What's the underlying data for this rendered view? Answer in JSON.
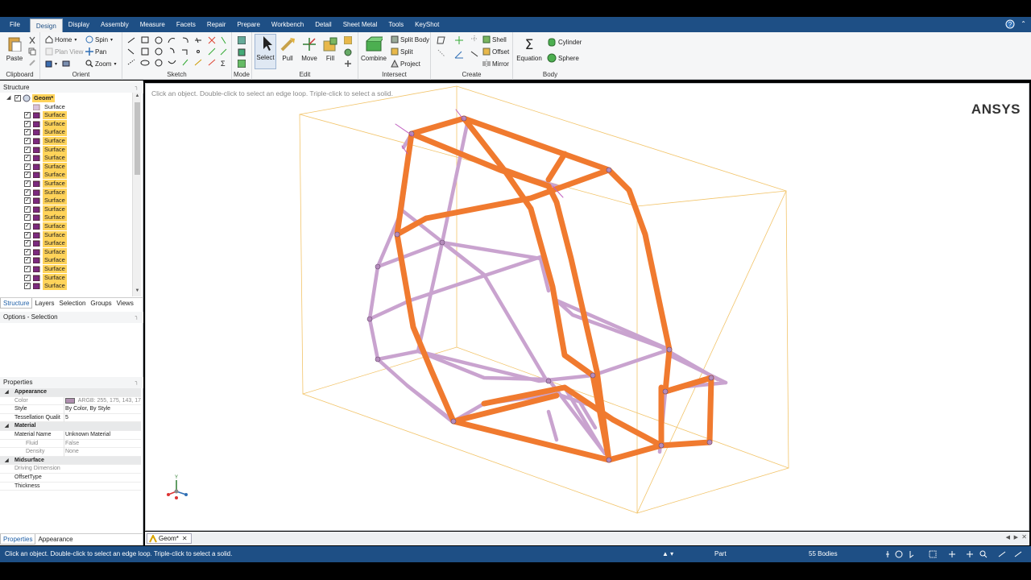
{
  "menu": {
    "file": "File",
    "items": [
      "Design",
      "Display",
      "Assembly",
      "Measure",
      "Facets",
      "Repair",
      "Prepare",
      "Workbench",
      "Detail",
      "Sheet Metal",
      "Tools",
      "KeyShot"
    ],
    "help_icon": "help-icon",
    "minimize_icon": "ribbon-minimize-icon"
  },
  "ribbon": {
    "clipboard": {
      "label": "Clipboard",
      "paste": "Paste"
    },
    "orient": {
      "label": "Orient",
      "home": "Home",
      "spin": "Spin",
      "plan_view": "Plan View",
      "pan": "Pan",
      "zoom": "Zoom"
    },
    "sketch": {
      "label": "Sketch"
    },
    "mode": {
      "label": "Mode"
    },
    "edit": {
      "label": "Edit",
      "select": "Select",
      "pull": "Pull",
      "move": "Move",
      "fill": "Fill"
    },
    "intersect": {
      "label": "Intersect",
      "combine": "Combine",
      "split_body": "Split Body",
      "split": "Split",
      "project": "Project"
    },
    "create": {
      "label": "Create",
      "shell": "Shell",
      "offset": "Offset",
      "mirror": "Mirror"
    },
    "body": {
      "label": "Body",
      "equation": "Equation",
      "cylinder": "Cylinder",
      "sphere": "Sphere"
    }
  },
  "structure": {
    "title": "Structure",
    "root": "Geom*",
    "first_item": "Surface",
    "item_label": "Surface",
    "visible_selected_rows": 21
  },
  "left_tabs": [
    "Structure",
    "Layers",
    "Selection",
    "Groups",
    "Views"
  ],
  "options_panel": {
    "title": "Options - Selection"
  },
  "properties": {
    "title": "Properties",
    "appearance": {
      "category": "Appearance",
      "color_key": "Color",
      "color_value": "ARGB: 255, 175, 143, 17",
      "color_swatch": "#af8faf",
      "style_key": "Style",
      "style_value": "By Color, By Style",
      "tess_key": "Tessellation Qualit",
      "tess_value": "5"
    },
    "material": {
      "category": "Material",
      "name_key": "Material Name",
      "name_value": "Unknown Material",
      "fluid_key": "Fluid",
      "fluid_value": "False",
      "density_key": "Density",
      "density_value": "None"
    },
    "midsurface": {
      "category": "Midsurface",
      "driving_key": "Driving Dimension",
      "offset_key": "OffsetType",
      "thickness_key": "Thickness"
    }
  },
  "bottom_tabs": [
    "Properties",
    "Appearance"
  ],
  "viewport": {
    "hint": "Click an object. Double-click to select an edge loop. Triple-click to select a solid.",
    "logo": "ANSYS",
    "triad_y": "Y",
    "colors": {
      "selected_tube": "#f07a2f",
      "unselected_tube": "#c9a3cf",
      "bbox": "#f2c46a"
    }
  },
  "doc_tab": {
    "label": "Geom*"
  },
  "status": {
    "message": "Click an object. Double-click to select an edge loop. Triple-click to select a solid.",
    "mode": "Part",
    "bodies": "55 Bodies"
  }
}
